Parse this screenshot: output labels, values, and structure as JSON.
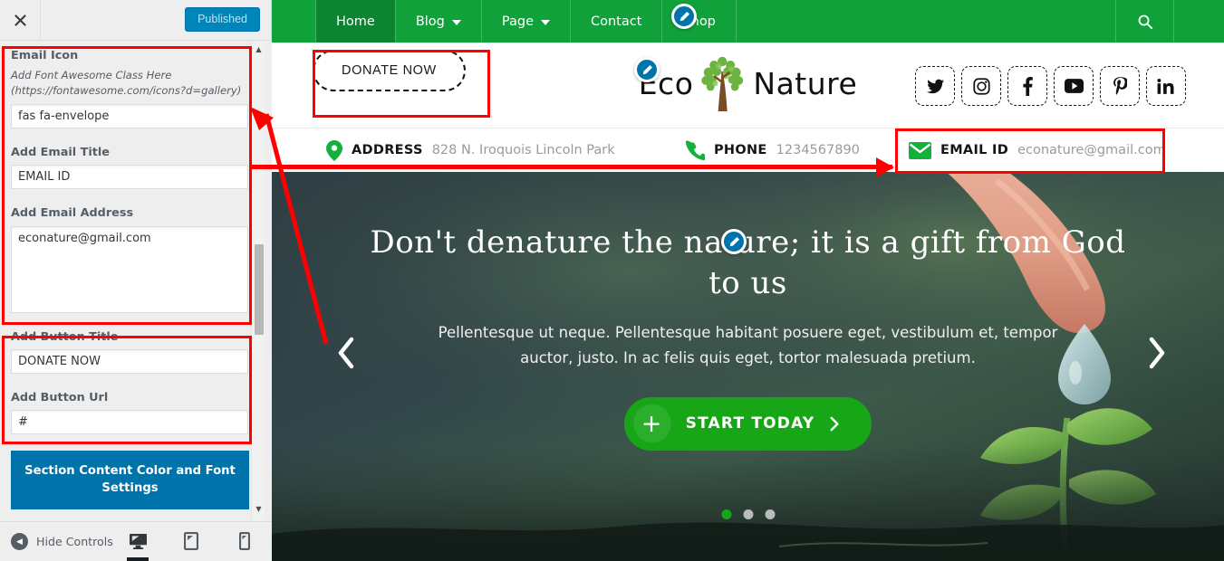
{
  "customizer": {
    "close_icon": "close-x-icon",
    "publish_label": "Published",
    "fields": {
      "email_icon": {
        "label": "Email Icon",
        "help": "Add Font Awesome Class Here (https://fontawesome.com/icons?d=gallery)",
        "value": "fas fa-envelope"
      },
      "email_title": {
        "label": "Add Email Title",
        "value": "EMAIL ID"
      },
      "email_address": {
        "label": "Add Email Address",
        "value": "econature@gmail.com"
      },
      "button_title": {
        "label": "Add Button Title",
        "value": "DONATE NOW"
      },
      "button_url": {
        "label": "Add Button Url",
        "value": "#"
      }
    },
    "section_button_label": "Section Content Color and Font Settings",
    "footer": {
      "hide_controls_label": "Hide Controls",
      "devices": [
        {
          "name": "desktop-preview-button",
          "icon": "desktop-icon",
          "active": true
        },
        {
          "name": "tablet-preview-button",
          "icon": "tablet-icon",
          "active": false
        },
        {
          "name": "mobile-preview-button",
          "icon": "mobile-icon",
          "active": false
        }
      ]
    }
  },
  "site": {
    "nav": {
      "items": [
        {
          "label": "Home",
          "has_dropdown": false,
          "active": true
        },
        {
          "label": "Blog",
          "has_dropdown": true,
          "active": false
        },
        {
          "label": "Page",
          "has_dropdown": true,
          "active": false
        },
        {
          "label": "Contact",
          "has_dropdown": false,
          "active": false
        },
        {
          "label": "Shop",
          "has_dropdown": false,
          "active": false
        }
      ],
      "search_icon": "search-icon"
    },
    "donate_button": "DONATE NOW",
    "logo_left": "Eco",
    "logo_right": "Nature",
    "socials": [
      {
        "name": "twitter",
        "glyph": "twitter-icon"
      },
      {
        "name": "instagram",
        "glyph": "instagram-icon"
      },
      {
        "name": "facebook",
        "glyph": "facebook-icon"
      },
      {
        "name": "youtube",
        "glyph": "youtube-icon"
      },
      {
        "name": "pinterest",
        "glyph": "pinterest-icon"
      },
      {
        "name": "linkedin",
        "glyph": "linkedin-icon"
      }
    ],
    "contact": {
      "address_label": "ADDRESS",
      "address_value": "828 N. Iroquois Lincoln Park",
      "phone_label": "PHONE",
      "phone_value": "1234567890",
      "email_label": "EMAIL ID",
      "email_value": "econature@gmail.com"
    },
    "hero": {
      "title": "Don't denature the nature; it is a gift from God to us",
      "subtitle": "Pellentesque ut neque. Pellentesque habitant posuere eget, vestibulum et, tempor auctor, justo. In ac felis quis eget, tortor malesuada pretium.",
      "cta_label": "START TODAY",
      "prev_icon": "chevron-left-icon",
      "next_icon": "chevron-right-icon",
      "slides": 3,
      "active_slide": 1
    }
  },
  "colors": {
    "brand_green": "#10a13b",
    "accent_blue": "#0073aa",
    "annotation_red": "#ff0000",
    "cta_green": "#16a616"
  }
}
